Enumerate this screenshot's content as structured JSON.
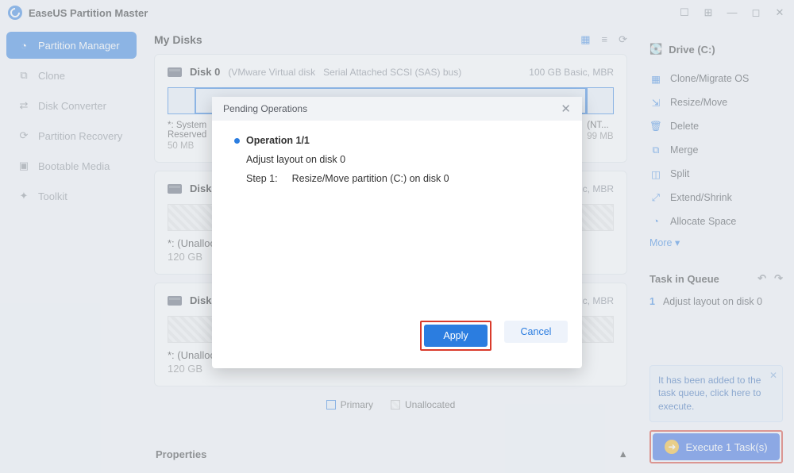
{
  "app_title": "EaseUS Partition Master",
  "sidebar": {
    "items": [
      {
        "label": "Partition Manager",
        "glyph": "◔"
      },
      {
        "label": "Clone",
        "glyph": "⧉"
      },
      {
        "label": "Disk Converter",
        "glyph": "⇄"
      },
      {
        "label": "Partition Recovery",
        "glyph": "⟳"
      },
      {
        "label": "Bootable Media",
        "glyph": "▣"
      },
      {
        "label": "Toolkit",
        "glyph": "✦"
      }
    ]
  },
  "main": {
    "title": "My Disks",
    "disks": [
      {
        "name": "Disk 0",
        "meta1": "(VMware   Virtual disk",
        "meta2": "Serial Attached SCSI (SAS) bus)",
        "right": "100 GB Basic, MBR",
        "p1_label": "*: System Reserved",
        "p1_sub": "50 MB",
        "p3_label": "(NT...",
        "p3_sub": "99 MB"
      },
      {
        "name": "Disk 1",
        "right": "Basic, MBR",
        "u_label": "*: (Unallocated)",
        "u_sub": "120 GB"
      },
      {
        "name": "Disk 2",
        "right": "Basic, MBR",
        "u_label": "*: (Unallocated)",
        "u_sub": "120 GB"
      }
    ],
    "legend_primary": "Primary",
    "legend_unalloc": "Unallocated",
    "properties": "Properties"
  },
  "rpanel": {
    "drive_label": "Drive (C:)",
    "actions": [
      {
        "label": "Clone/Migrate OS",
        "glyph": "▦"
      },
      {
        "label": "Resize/Move",
        "glyph": "⇲"
      },
      {
        "label": "Delete",
        "glyph": "🗑"
      },
      {
        "label": "Merge",
        "glyph": "⧉"
      },
      {
        "label": "Split",
        "glyph": "◫"
      },
      {
        "label": "Extend/Shrink",
        "glyph": "⤢"
      },
      {
        "label": "Allocate Space",
        "glyph": "◔"
      }
    ],
    "more": "More  ▾",
    "queue_title": "Task in Queue",
    "queue_num": "1",
    "queue_item": "Adjust layout on disk 0",
    "tip": "It has been added to the task queue, click here to execute.",
    "exec": "Execute 1 Task(s)"
  },
  "modal": {
    "title": "Pending Operations",
    "op_header": "Operation 1/1",
    "op_desc": "Adjust layout on disk 0",
    "step_lbl": "Step 1:",
    "step_txt": "Resize/Move partition (C:) on disk 0",
    "apply": "Apply",
    "cancel": "Cancel"
  }
}
